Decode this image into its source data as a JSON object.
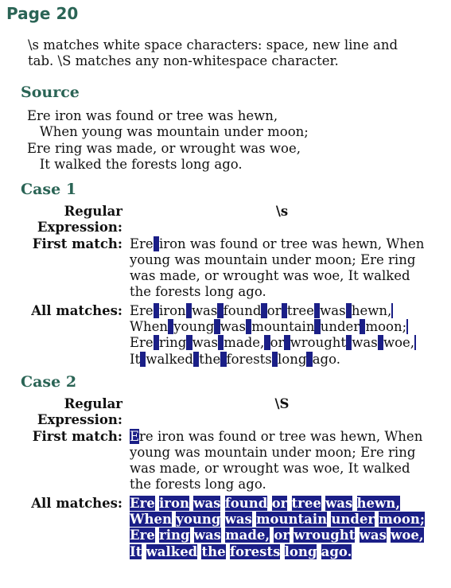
{
  "page_title": "Page 20",
  "intro": "\\s matches white space characters: space, new line and tab. \\S matches any non-whitespace character.",
  "source_heading": "Source",
  "source_lines": [
    "Ere iron was found or tree was hewn,",
    "   When young was mountain under moon;",
    "Ere ring was made, or wrought was woe,",
    "   It walked the forests long ago."
  ],
  "cases": [
    {
      "heading": "Case 1",
      "regex_label": "Regular Expression:",
      "regex": "\\s",
      "first_label": "First match:",
      "first_match_text": "Ere iron was found or tree was hewn, When young was mountain under moon; Ere ring was made, or wrought was woe, It walked the forests long ago.",
      "all_label": "All matches:",
      "all_matches_text": "Ere iron was found or tree was hewn, When young was mountain under moon; Ere ring was made, or wrought was woe, It walked the forests long ago."
    },
    {
      "heading": "Case 2",
      "regex_label": "Regular Expression:",
      "regex": "\\S",
      "first_label": "First match:",
      "first_match_text": "Ere iron was found or tree was hewn, When young was mountain under moon; Ere ring was made, or wrought was woe, It walked the forests long ago.",
      "all_label": "All matches:",
      "all_matches_text": "Ere iron was found or tree was hewn, When young was mountain under moon; Ere ring was made, or wrought was woe, It walked the forests long ago."
    }
  ],
  "highlight_color": "#1b1f87",
  "heading_color": "#2a6455"
}
